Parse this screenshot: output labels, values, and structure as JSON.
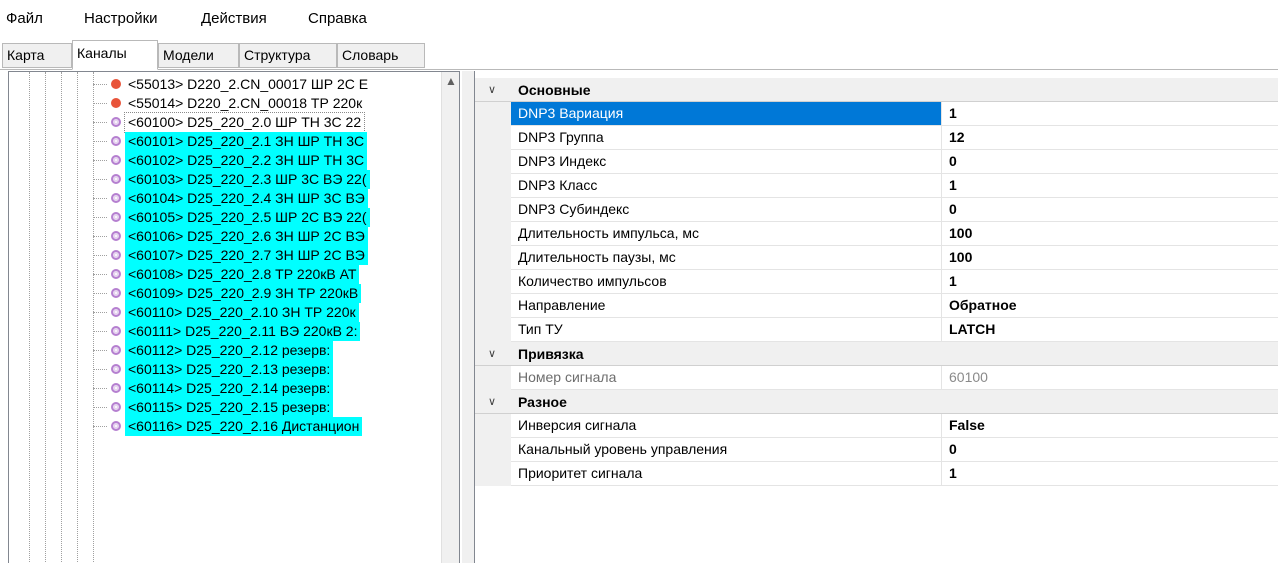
{
  "menu": {
    "file": "Файл",
    "settings": "Настройки",
    "actions": "Действия",
    "help": "Справка"
  },
  "tabs": {
    "map": "Карта",
    "channels": "Каналы",
    "models": "Модели",
    "structure": "Структура",
    "dictionary": "Словарь",
    "active": "Каналы"
  },
  "tree": {
    "items": [
      {
        "text": "<55013> D220_2.CN_00017 ШР 2С Е",
        "dot": "#e8543a",
        "style": "normal"
      },
      {
        "text": "<55014> D220_2.CN_00018 ТР 220к",
        "dot": "#e8543a",
        "style": "normal"
      },
      {
        "text": "<60100> D25_220_2.0 ШР ТН 3С 22",
        "dot": "#b57fd0",
        "style": "selected"
      },
      {
        "text": "<60101> D25_220_2.1 ЗН ШР ТН 3С",
        "dot": "#b57fd0",
        "style": "highlight"
      },
      {
        "text": "<60102> D25_220_2.2 ЗН ШР ТН 3С",
        "dot": "#b57fd0",
        "style": "highlight"
      },
      {
        "text": "<60103> D25_220_2.3 ШР 3С ВЭ 22(",
        "dot": "#b57fd0",
        "style": "highlight"
      },
      {
        "text": "<60104> D25_220_2.4 ЗН ШР 3С ВЭ",
        "dot": "#b57fd0",
        "style": "highlight"
      },
      {
        "text": "<60105> D25_220_2.5 ШР 2С ВЭ 22(",
        "dot": "#b57fd0",
        "style": "highlight"
      },
      {
        "text": "<60106> D25_220_2.6 ЗН ШР 2С ВЭ",
        "dot": "#b57fd0",
        "style": "highlight"
      },
      {
        "text": "<60107> D25_220_2.7 ЗН ШР 2С ВЭ",
        "dot": "#b57fd0",
        "style": "highlight"
      },
      {
        "text": "<60108> D25_220_2.8 ТР 220кВ АТ",
        "dot": "#b57fd0",
        "style": "highlight"
      },
      {
        "text": "<60109> D25_220_2.9 ЗН ТР 220кВ",
        "dot": "#b57fd0",
        "style": "highlight"
      },
      {
        "text": "<60110> D25_220_2.10 ЗН ТР 220к",
        "dot": "#b57fd0",
        "style": "highlight"
      },
      {
        "text": "<60111> D25_220_2.11 ВЭ 220кВ 2:",
        "dot": "#b57fd0",
        "style": "highlight"
      },
      {
        "text": "<60112> D25_220_2.12 резерв:",
        "dot": "#b57fd0",
        "style": "highlight"
      },
      {
        "text": "<60113> D25_220_2.13 резерв:",
        "dot": "#b57fd0",
        "style": "highlight"
      },
      {
        "text": "<60114> D25_220_2.14 резерв:",
        "dot": "#b57fd0",
        "style": "highlight"
      },
      {
        "text": "<60115> D25_220_2.15 резерв:",
        "dot": "#b57fd0",
        "style": "highlight"
      },
      {
        "text": "<60116> D25_220_2.16 Дистанцион",
        "dot": "#b57fd0",
        "style": "highlight"
      }
    ]
  },
  "properties": {
    "categories": [
      {
        "label": "Основные",
        "rows": [
          {
            "name": "DNP3 Вариация",
            "value": "1",
            "selected": true
          },
          {
            "name": "DNP3 Группа",
            "value": "12"
          },
          {
            "name": "DNP3 Индекс",
            "value": "0"
          },
          {
            "name": "DNP3 Класс",
            "value": "1"
          },
          {
            "name": "DNP3 Субиндекс",
            "value": "0"
          },
          {
            "name": "Длительность импульса, мс",
            "value": "100"
          },
          {
            "name": "Длительность паузы, мс",
            "value": "100"
          },
          {
            "name": "Количество импульсов",
            "value": "1"
          },
          {
            "name": "Направление",
            "value": "Обратное"
          },
          {
            "name": "Тип ТУ",
            "value": "LATCH"
          }
        ]
      },
      {
        "label": "Привязка",
        "rows": [
          {
            "name": "Номер сигнала",
            "value": "60100",
            "readonly": true
          }
        ]
      },
      {
        "label": "Разное",
        "rows": [
          {
            "name": "Инверсия сигнала",
            "value": "False"
          },
          {
            "name": "Канальный уровень управления",
            "value": "0"
          },
          {
            "name": "Приоритет сигнала",
            "value": "1"
          }
        ]
      }
    ]
  },
  "colors": {
    "highlight": "#00ffff",
    "selection": "#0078d7",
    "dot_red": "#e8543a",
    "dot_purple": "#b57fd0"
  }
}
